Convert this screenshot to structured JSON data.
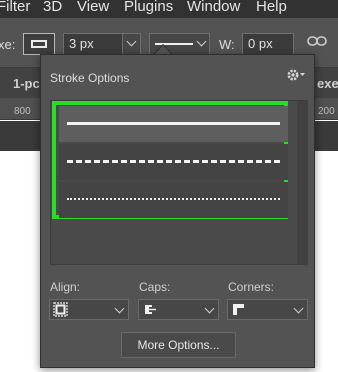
{
  "menubar": {
    "items": [
      "Filter",
      "3D",
      "View",
      "Plugins",
      "Window",
      "Help"
    ]
  },
  "options_bar": {
    "stroke_label_partial": "xe:",
    "stroke_width": "3 px",
    "width_label": "W:",
    "width_value": "0 px"
  },
  "document": {
    "tab_partial": "1-pc",
    "tab_partial_right": "exe",
    "ruler": [
      "800",
      "200"
    ]
  },
  "stroke_panel": {
    "title": "Stroke Options",
    "line_styles": [
      "solid",
      "dashed",
      "dotted"
    ],
    "align_label": "Align:",
    "caps_label": "Caps:",
    "corners_label": "Corners:",
    "more_options": "More Options...",
    "highlight_color": "#2bdb2b"
  }
}
